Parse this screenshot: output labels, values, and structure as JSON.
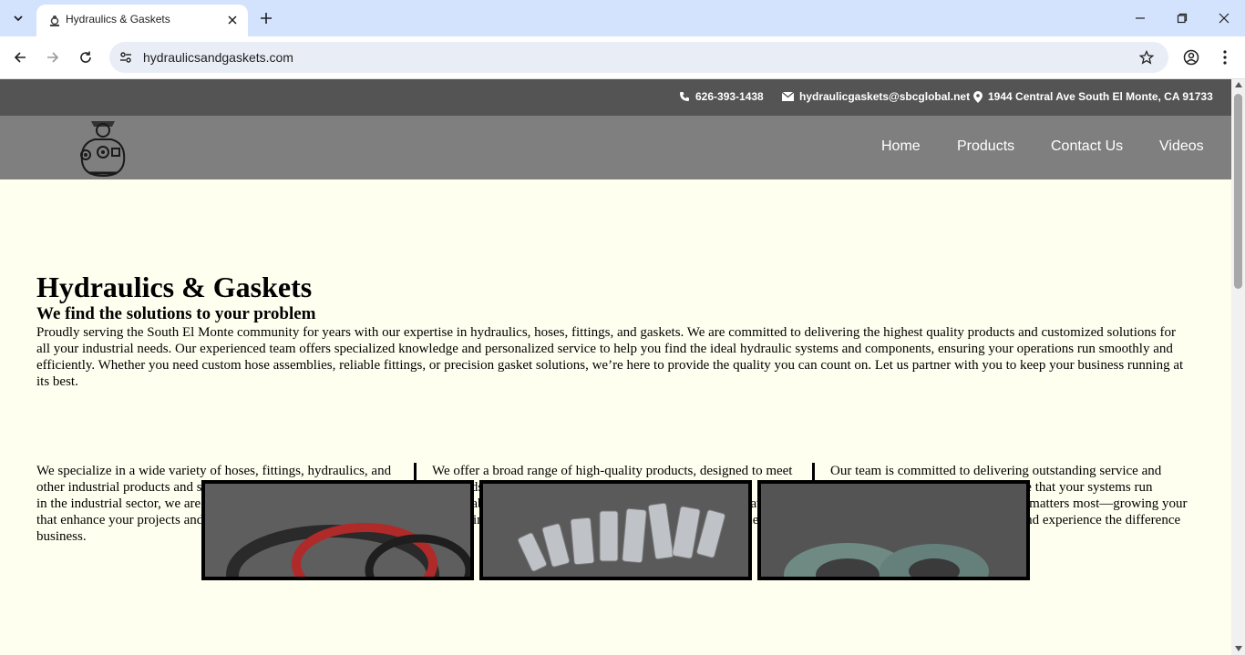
{
  "browser": {
    "tab_title": "Hydraulics & Gaskets",
    "url": "hydraulicsandgaskets.com",
    "icons": [
      "tab-list-icon",
      "close-icon",
      "plus-icon",
      "minimize-icon",
      "restore-icon",
      "close-window-icon",
      "back-icon",
      "forward-icon",
      "reload-icon",
      "site-info-icon",
      "star-icon",
      "profile-icon",
      "menu-icon"
    ]
  },
  "contact": {
    "phone": "626-393-1438",
    "email": "hydraulicgaskets@sbcglobal.net",
    "address": "1944 Central Ave South El Monte, CA 91733"
  },
  "nav": {
    "items": [
      {
        "label": "Home"
      },
      {
        "label": "Products"
      },
      {
        "label": "Contact Us"
      },
      {
        "label": "Videos"
      }
    ]
  },
  "hero": {
    "title": "Hydraulics & Gaskets",
    "subtitle": "We find the solutions to your problem",
    "intro": "Proudly serving the South El Monte community for years with our expertise in hydraulics, hoses, fittings, and gaskets. We are committed to delivering the highest quality products and customized solutions for all your industrial needs. Our experienced team offers specialized knowledge and personalized service to help you find the ideal hydraulic systems and components, ensuring your operations run smoothly and efficiently. Whether you need custom hose assemblies, reliable fittings, or precision gasket solutions, we’re here to provide the quality you can count on. Let us partner with you to keep your business running at its best."
  },
  "columns": [
    {
      "text": "We specialize in a wide variety of hoses, fittings, hydraulics, and other industrial products and services. With years of experience in the industrial sector, we are dedicated to providing solutions that enhance your projects and contribute to the growth of your business."
    },
    {
      "text": "We offer a broad range of high-quality products, designed to meet the needs of diverse industries. Whether it's durable hoses, dependable fittings, or advanced hydraulic solutions, we have everything necessary to keep your systems operating efficiently."
    },
    {
      "text": "Our team is committed to delivering outstanding service and premium products. We aim to ensure that your systems run smoothly, so you can focus on what matters most—growing your business. Explore our range today and experience the difference in quality and performance."
    }
  ],
  "gallery": [
    {
      "subject": "hose-seals-image"
    },
    {
      "subject": "fittings-image"
    },
    {
      "subject": "gaskets-image"
    }
  ],
  "colors": {
    "chrome_tabbar": "#d3e3fd",
    "topbar": "#545454",
    "navbar": "#7f7f7f",
    "page_bg": "#fffff0"
  }
}
